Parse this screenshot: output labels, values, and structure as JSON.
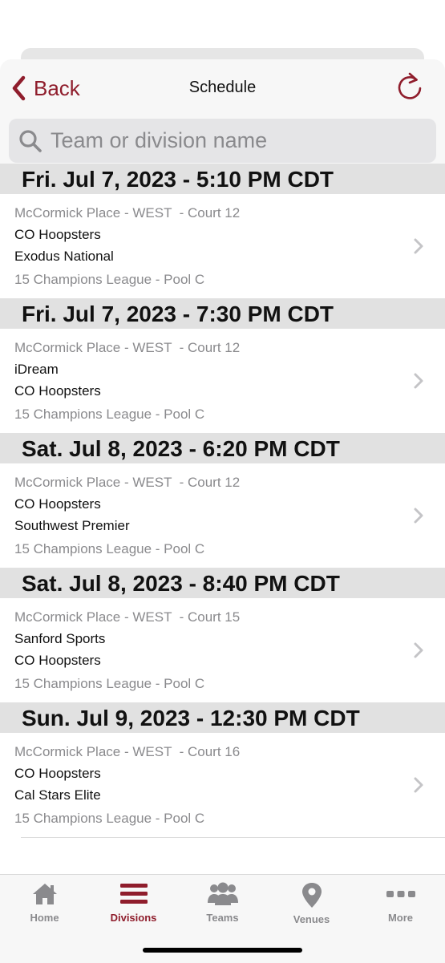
{
  "navbar": {
    "back_label": "Back",
    "title": "Schedule"
  },
  "search": {
    "placeholder": "Team or division name"
  },
  "games": [
    {
      "date": "Fri. Jul 7, 2023 - 5:10 PM CDT",
      "venue": "McCormick Place - WEST  - Court 12",
      "team1": "CO Hoopsters",
      "team2": "Exodus National",
      "league": "15 Champions League - Pool C"
    },
    {
      "date": "Fri. Jul 7, 2023 - 7:30 PM CDT",
      "venue": "McCormick Place - WEST  - Court 12",
      "team1": "iDream",
      "team2": "CO Hoopsters",
      "league": "15 Champions League - Pool C"
    },
    {
      "date": "Sat. Jul 8, 2023 - 6:20 PM CDT",
      "venue": "McCormick Place - WEST  - Court 12",
      "team1": "CO Hoopsters",
      "team2": "Southwest Premier",
      "league": "15 Champions League - Pool C"
    },
    {
      "date": "Sat. Jul 8, 2023 - 8:40 PM CDT",
      "venue": "McCormick Place - WEST  - Court 15",
      "team1": "Sanford Sports",
      "team2": "CO Hoopsters",
      "league": "15 Champions League - Pool C"
    },
    {
      "date": "Sun. Jul 9, 2023 - 12:30 PM CDT",
      "venue": "McCormick Place - WEST  - Court 16",
      "team1": "CO Hoopsters",
      "team2": "Cal Stars Elite",
      "league": "15 Champions League - Pool C"
    }
  ],
  "tabbar": {
    "items": [
      {
        "label": "Home",
        "icon": "home-icon",
        "active": false
      },
      {
        "label": "Divisions",
        "icon": "divisions-icon",
        "active": true
      },
      {
        "label": "Teams",
        "icon": "teams-icon",
        "active": false
      },
      {
        "label": "Venues",
        "icon": "venues-icon",
        "active": false
      },
      {
        "label": "More",
        "icon": "more-icon",
        "active": false
      }
    ]
  },
  "colors": {
    "accent": "#8f1d2c",
    "inactive": "#8a8a8d",
    "section_header_bg": "#e1e1e1"
  }
}
